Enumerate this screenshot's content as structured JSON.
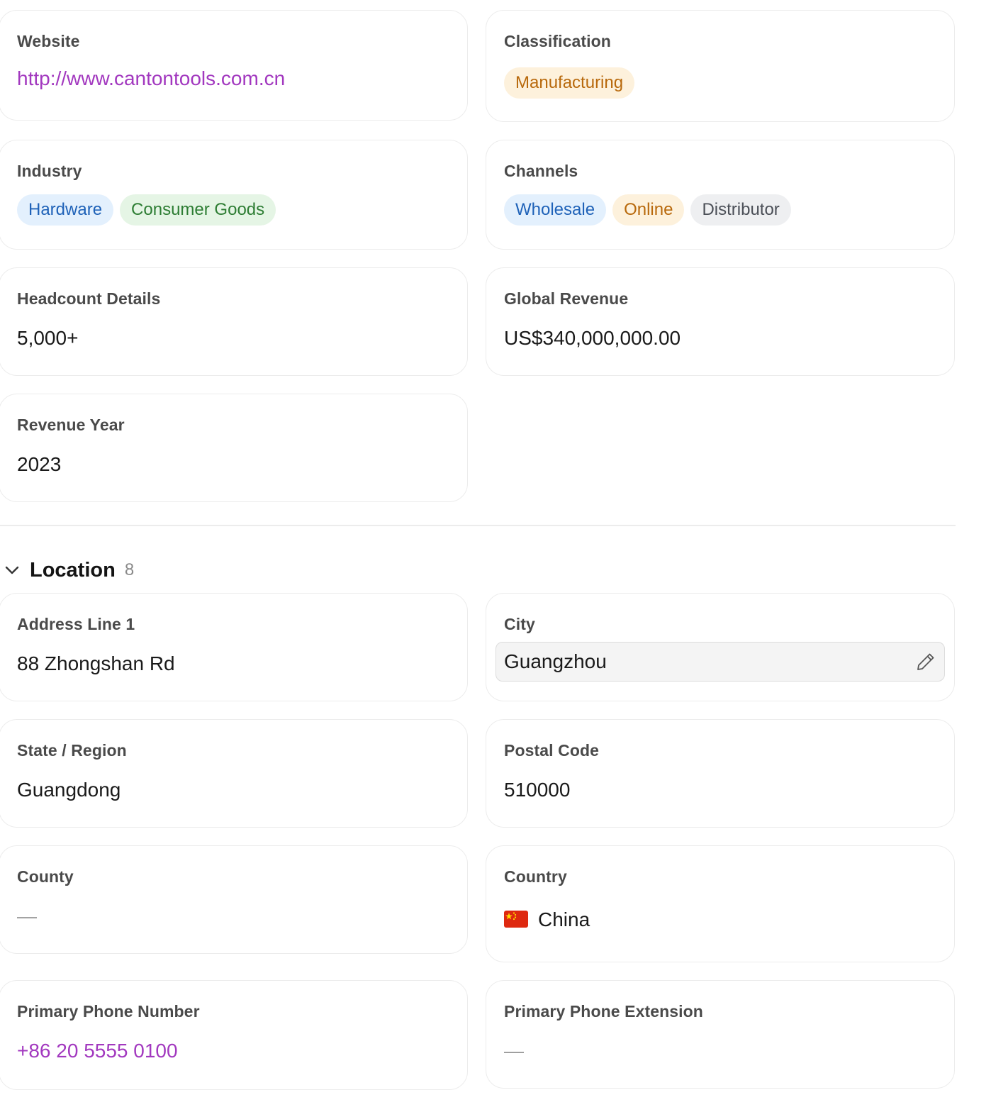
{
  "overview": {
    "website": {
      "label": "Website",
      "value": "http://www.cantontools.com.cn"
    },
    "classification": {
      "label": "Classification",
      "tags": [
        "Manufacturing"
      ]
    },
    "industry": {
      "label": "Industry",
      "tags": [
        "Hardware",
        "Consumer Goods"
      ]
    },
    "channels": {
      "label": "Channels",
      "tags": [
        "Wholesale",
        "Online",
        "Distributor"
      ]
    },
    "headcount": {
      "label": "Headcount Details",
      "value": "5,000+"
    },
    "global_revenue": {
      "label": "Global Revenue",
      "value": "US$340,000,000.00"
    },
    "revenue_year": {
      "label": "Revenue Year",
      "value": "2023"
    }
  },
  "location": {
    "title": "Location",
    "count": "8",
    "address_line_1": {
      "label": "Address Line 1",
      "value": "88 Zhongshan Rd"
    },
    "city": {
      "label": "City",
      "value": "Guangzhou"
    },
    "state_region": {
      "label": "State / Region",
      "value": "Guangdong"
    },
    "postal_code": {
      "label": "Postal Code",
      "value": "510000"
    },
    "county": {
      "label": "County",
      "value": "—"
    },
    "country": {
      "label": "Country",
      "value": "China",
      "flag_icon": "china-flag-icon"
    },
    "primary_phone": {
      "label": "Primary Phone Number",
      "value": "+86 20 5555 0100"
    },
    "primary_phone_ext": {
      "label": "Primary Phone Extension",
      "value": "—"
    }
  },
  "colors": {
    "link": "#a238bf",
    "pill_blue_bg": "#e3f0fd",
    "pill_blue_text": "#1f62b8",
    "pill_green_bg": "#e5f5e5",
    "pill_green_text": "#2d7d33",
    "pill_amber_bg": "#fdf1dc",
    "pill_amber_text": "#b8690c",
    "pill_gray_bg": "#eeeff1",
    "pill_gray_text": "#4b4f57"
  }
}
